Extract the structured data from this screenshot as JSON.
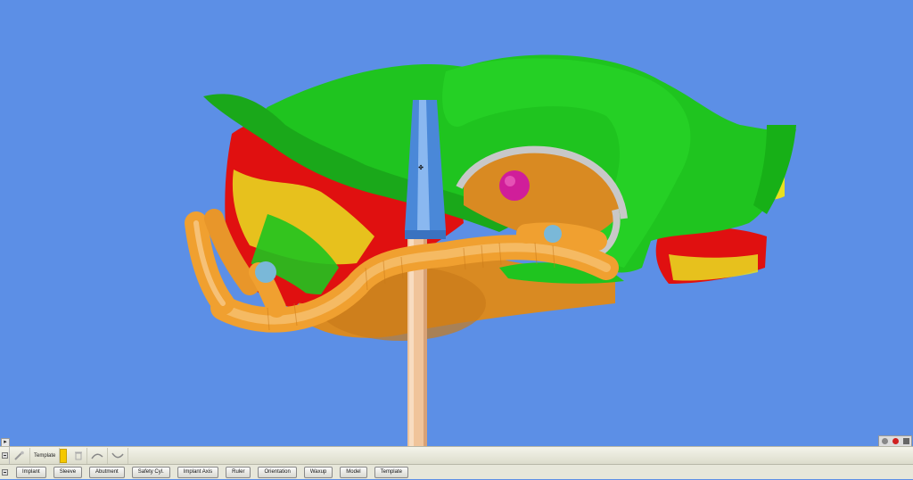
{
  "toolbar": {
    "template_label": "Template",
    "icons": [
      "wand-icon",
      "trash-icon",
      "curve-icon",
      "curve-alt-icon"
    ]
  },
  "tabs": [
    {
      "label": "Implant"
    },
    {
      "label": "Sleeve"
    },
    {
      "label": "Abutment"
    },
    {
      "label": "Safety Cyl."
    },
    {
      "label": "Implant Axis"
    },
    {
      "label": "Ruler"
    },
    {
      "label": "Orientation"
    },
    {
      "label": "Waxup"
    },
    {
      "label": "Model"
    },
    {
      "label": "Template"
    }
  ],
  "colors": {
    "viewport_bg": "#5c8fe6",
    "tissue_green": "#1fc41f",
    "tissue_red": "#e01010",
    "tissue_yellow": "#e8e020",
    "implant_orange": "#f0a030",
    "sleeve_blue": "#4a88d8",
    "toolbar_swatch": "#f5c800"
  }
}
